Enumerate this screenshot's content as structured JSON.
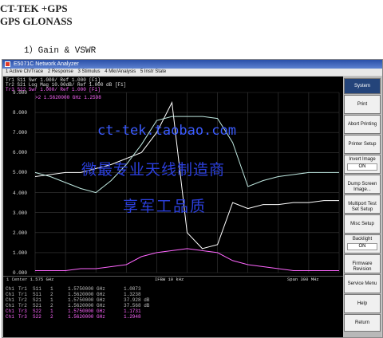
{
  "doc": {
    "title_line1": "CT-TEK +GPS",
    "title_line2": "GPS GLONASS",
    "section": "1）Gain & VSWR"
  },
  "window": {
    "title": "E5071C Network Analyzer",
    "menu": [
      "1 Active Ch/Trace",
      "2 Response",
      "3 Stimulus",
      "4 Mkr/Analysis",
      "5 Instr State"
    ]
  },
  "traces_header": [
    {
      "text": "Tr1 S11 Swr 1.000/ Ref 1.000 [F1]",
      "color": "#e0e0e0"
    },
    {
      "text": "Tr2 S21 Log Mag 10.00dB/ Ref 1.000 dB [F1]",
      "color": "#e0e0e0"
    },
    {
      "text": "Tr3 S22 Swr 1.000/ Ref 1.000 [F1]",
      "color": "#ff66ff"
    }
  ],
  "marker_readout": ">2  1.5620000 GHz  1.2598",
  "yaxis_ticks": [
    "9.000",
    "8.000",
    "7.000",
    "6.000",
    "5.000",
    "4.000",
    "3.000",
    "2.000",
    "1.000",
    "0.000"
  ],
  "status": {
    "start": "1  Center 1.575 GHz",
    "ifbw": "IFBW 10 kHz",
    "span": "Span 300 MHz"
  },
  "markers_table": [
    {
      "ch": "Ch1",
      "tr": "Tr1",
      "param": "S11",
      "num": "1",
      "freq": "1.5750000 GHz",
      "val": "1.0873",
      "color": "#bfbfbf"
    },
    {
      "ch": "Ch1",
      "tr": "Tr1",
      "param": "S11",
      "num": "2",
      "freq": "1.5620000 GHz",
      "val": "1.3238",
      "color": "#bfbfbf"
    },
    {
      "ch": "Ch1",
      "tr": "Tr2",
      "param": "S21",
      "num": "1",
      "freq": "1.5750000 GHz",
      "val": "37.928 dB",
      "color": "#bfbfbf"
    },
    {
      "ch": "Ch1",
      "tr": "Tr2",
      "param": "S21",
      "num": "2",
      "freq": "1.5620000 GHz",
      "val": "37.568 dB",
      "color": "#bfbfbf"
    },
    {
      "ch": "Ch1",
      "tr": "Tr3",
      "param": "S22",
      "num": "1",
      "freq": "1.5750000 GHz",
      "val": "1.1731",
      "color": "#ff66ff"
    },
    {
      "ch": "Ch1",
      "tr": "Tr3",
      "param": "S22",
      "num": "2",
      "freq": "1.5620000 GHz",
      "val": "1.2948",
      "color": "#ff66ff"
    }
  ],
  "softkeys": [
    {
      "label": "System",
      "value": "",
      "style": "blue"
    },
    {
      "label": "Print",
      "value": "",
      "style": ""
    },
    {
      "label": "Abort Printing",
      "value": "",
      "style": ""
    },
    {
      "label": "Printer Setup",
      "value": "",
      "style": ""
    },
    {
      "label": "Invert Image",
      "value": "ON",
      "style": ""
    },
    {
      "label": "Dump Screen Image...",
      "value": "",
      "style": ""
    },
    {
      "label": "Multiport Test Set Setup",
      "value": "",
      "style": ""
    },
    {
      "label": "Misc Setup",
      "value": "",
      "style": ""
    },
    {
      "label": "Backlight",
      "value": "ON",
      "style": ""
    },
    {
      "label": "Firmware Revision",
      "value": "",
      "style": ""
    },
    {
      "label": "Service Menu",
      "value": "",
      "style": ""
    },
    {
      "label": "Help",
      "value": "",
      "style": ""
    },
    {
      "label": "Return",
      "value": "",
      "style": ""
    }
  ],
  "watermark": {
    "url": "ct-tek.taobao.com",
    "line1": "微最专业天线制造商",
    "line2": "享军工品质"
  },
  "chart_data": {
    "type": "line",
    "ylim": [
      0,
      9
    ],
    "x": [
      0,
      0.05,
      0.1,
      0.15,
      0.2,
      0.25,
      0.3,
      0.35,
      0.4,
      0.45,
      0.5,
      0.55,
      0.6,
      0.65,
      0.7,
      0.75,
      0.8,
      0.85,
      0.9,
      0.95,
      1.0
    ],
    "series": [
      {
        "color": "#ffffff",
        "values": [
          4.8,
          4.9,
          5.0,
          5.0,
          5.2,
          5.4,
          5.7,
          6.0,
          7.0,
          8.5,
          2.0,
          1.2,
          1.4,
          3.5,
          3.2,
          3.4,
          3.4,
          3.5,
          3.5,
          3.6,
          3.6
        ]
      },
      {
        "color": "#bfe8e0",
        "values": [
          5.0,
          4.8,
          4.5,
          4.2,
          4.0,
          4.6,
          5.4,
          6.4,
          7.6,
          7.8,
          7.8,
          7.8,
          7.7,
          6.5,
          4.3,
          4.6,
          4.8,
          4.9,
          5.0,
          5.0,
          5.0
        ]
      },
      {
        "color": "#ff66ff",
        "values": [
          0.1,
          0.1,
          0.1,
          0.2,
          0.2,
          0.3,
          0.4,
          0.8,
          1.0,
          1.1,
          1.2,
          1.1,
          1.0,
          0.6,
          0.4,
          0.3,
          0.2,
          0.1,
          0.1,
          0.1,
          0.1
        ]
      }
    ]
  }
}
